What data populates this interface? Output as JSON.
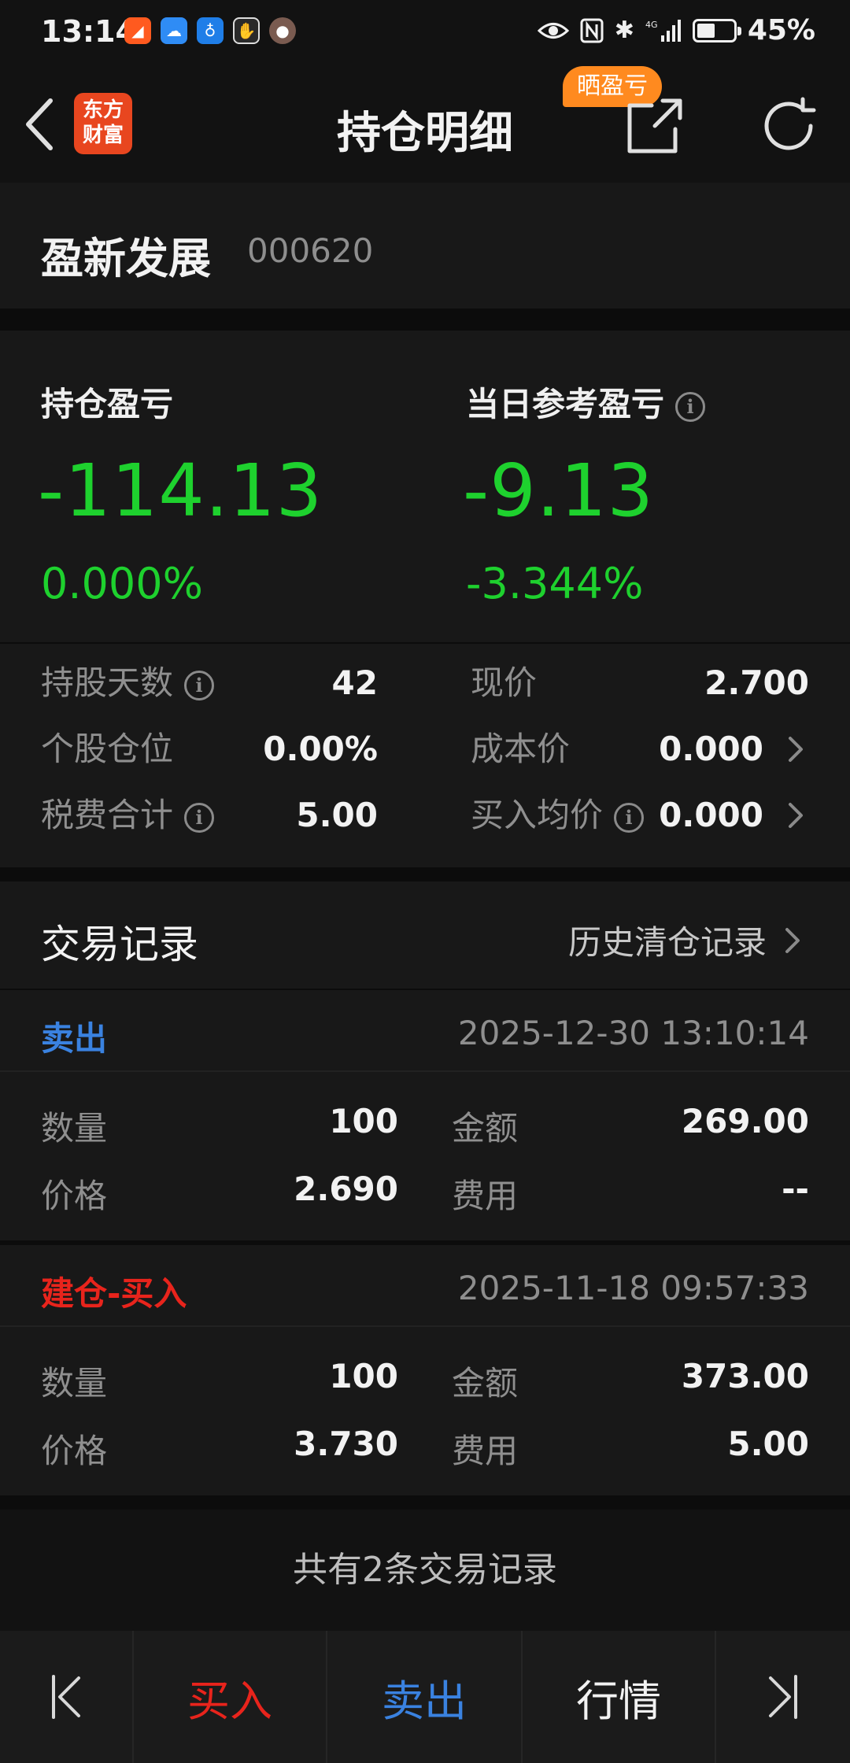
{
  "status_bar": {
    "time": "13:14",
    "battery_pct": "45%",
    "battery_level": 0.45,
    "notification_icons": [
      "app-notification-icon",
      "cloud-icon",
      "lightbulb-icon",
      "hand-icon",
      "avatar-icon"
    ],
    "system_icons": [
      "eye-icon",
      "nfc-icon",
      "bluetooth-icon",
      "signal-icon"
    ],
    "signal_label": "4G"
  },
  "header": {
    "logo_line1": "东方",
    "logo_line2": "财富",
    "title": "持仓明细",
    "share_badge": "晒盈亏"
  },
  "stock": {
    "name": "盈新发展",
    "code": "000620"
  },
  "summary": {
    "position_pl_label": "持仓盈亏",
    "position_pl_value": "-114.13",
    "position_pl_pct": "0.000%",
    "daily_pl_label": "当日参考盈亏",
    "daily_pl_value": "-9.13",
    "daily_pl_pct": "-3.344%",
    "loss_color": "#1ed12e"
  },
  "details": {
    "hold_days_label": "持股天数",
    "hold_days_value": "42",
    "current_price_label": "现价",
    "current_price_value": "2.700",
    "position_ratio_label": "个股仓位",
    "position_ratio_value": "0.00%",
    "cost_price_label": "成本价",
    "cost_price_value": "0.000",
    "tax_fee_label": "税费合计",
    "tax_fee_value": "5.00",
    "avg_buy_price_label": "买入均价",
    "avg_buy_price_value": "0.000"
  },
  "records": {
    "title": "交易记录",
    "history_link": "历史清仓记录",
    "items": [
      {
        "type": "卖出",
        "type_color": "#3a82e0",
        "time": "2025-12-30 13:10:14",
        "qty_label": "数量",
        "qty": "100",
        "amount_label": "金额",
        "amount": "269.00",
        "price_label": "价格",
        "price": "2.690",
        "fee_label": "费用",
        "fee": "--"
      },
      {
        "type": "建仓-买入",
        "type_color": "#e8241c",
        "time": "2025-11-18 09:57:33",
        "qty_label": "数量",
        "qty": "100",
        "amount_label": "金额",
        "amount": "373.00",
        "price_label": "价格",
        "price": "3.730",
        "fee_label": "费用",
        "fee": "5.00"
      }
    ],
    "total_text": "共有2条交易记录"
  },
  "bottom_bar": {
    "buy_label": "买入",
    "sell_label": "卖出",
    "quote_label": "行情",
    "buy_color": "#e8241c",
    "sell_color": "#3a82e0"
  }
}
